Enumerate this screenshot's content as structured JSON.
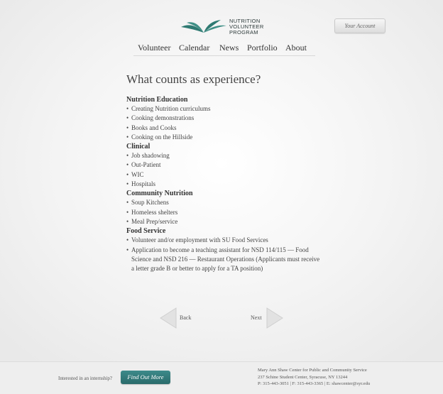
{
  "header": {
    "logo_lines": [
      "NUTRITION",
      "VOLUNTEER",
      "PROGRAM"
    ],
    "account_label": "Your Account"
  },
  "nav": {
    "items": [
      "Volunteer",
      "Calendar",
      "News",
      "Portfolio",
      "About"
    ]
  },
  "content": {
    "title": "What counts as experience?",
    "sections": [
      {
        "title": "Nutrition Education",
        "items": [
          "Creating Nutrition curriculums",
          "Cooking demonstrations",
          "Books and Cooks",
          "Cooking on the Hillside"
        ]
      },
      {
        "title": "Clinical",
        "items": [
          "Job shadowing",
          "Out-Patient",
          "WIC",
          "Hospitals"
        ]
      },
      {
        "title": "Community Nutrition",
        "items": [
          "Soup Kitchens",
          "Homeless shelters",
          "Meal Prep/service"
        ]
      },
      {
        "title": "Food Service",
        "items": [
          "Volunteer and/or employment with SU Food Services",
          "Application to become a teaching assistant for NSD 114/115 — Food Science and NSD 216 — Restaurant Operations (Applicants must receive a letter grade B or better to apply for a TA position)"
        ]
      }
    ]
  },
  "pager": {
    "back_label": "Back",
    "next_label": "Next"
  },
  "footer": {
    "internship_text": "Interested in an internship?",
    "find_button": "Find Out More",
    "address_lines": [
      "Mary Ann Shaw Center for Public and Community Service",
      "237 Schine Student Center, Syracuse, NY 13244",
      "P: 315-443-3051 | F: 315-443-3365 | E: shawcenter@syr.edu"
    ]
  },
  "colors": {
    "brand_teal": "#2a6b6b",
    "logo_green": "#2f7a72",
    "text": "#3a3a3a"
  },
  "icons": {
    "logo": "open-book-leaf-icon",
    "prev": "left-arrow-icon",
    "next": "right-arrow-icon"
  }
}
